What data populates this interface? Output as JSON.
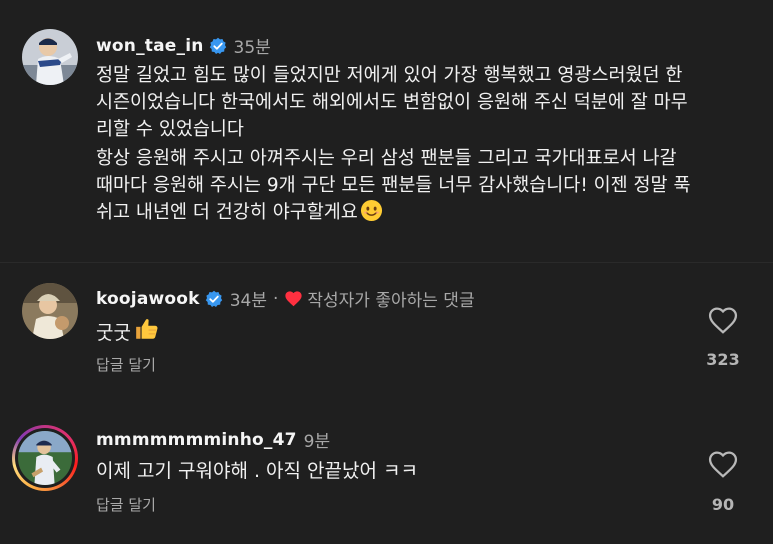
{
  "post": {
    "username": "won_tae_in",
    "time": "35분",
    "paragraphs": [
      [
        "정말 길었고 힘도 많이 들었지만 저에게 있어 가장 행복했고 영광스러웠던 한",
        "시즌이었습니다 한국에서도 해외에서도 변함없이 응원해 주신 덕분에 잘 마무",
        "리할 수 있었습니다"
      ],
      [
        "항상 응원해 주시고 아껴주시는 우리 삼성 팬분들 그리고 국가대표로서 나갈",
        "때마다 응원해 주시는 9개 구단 모든 팬분들 너무 감사했습니다! 이젠 정말 푹",
        "쉬고 내년엔 더 건강히 야구할게요"
      ]
    ],
    "ending_emoji": "smiling-face-emoji"
  },
  "comments": [
    {
      "username": "koojawook",
      "time": "34분",
      "liked_by_author_label": "작성자가 좋아하는 댓글",
      "text": "굿굿",
      "emoji": "thumbs-up-emoji",
      "reply_label": "답글 달기",
      "like_count": "323"
    },
    {
      "username": "mmmmmmminho_47",
      "time": "9분",
      "text": "이제 고기 구워야해 . 아직 안끝났어 ㅋㅋ",
      "reply_label": "답글 달기",
      "like_count": "90"
    }
  ],
  "colors": {
    "background": "#1f1f1f",
    "verified_badge": "#3897f0",
    "heart_red": "#ff3040",
    "muted_text": "#a8a8a8"
  },
  "icons": {
    "verified": "verified-badge-icon",
    "like": "heart-outline-icon",
    "author_liked": "heart-filled-icon"
  }
}
